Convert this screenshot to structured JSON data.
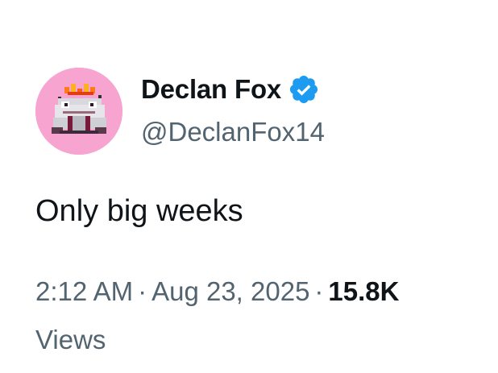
{
  "tweet": {
    "author": {
      "display_name": "Declan Fox",
      "handle": "@DeclanFox14",
      "verified": true,
      "verified_icon": "verified-badge-icon",
      "avatar_icon": "pixel-frog-avatar"
    },
    "text": "Only big weeks",
    "time": "2:12 AM",
    "separator": "·",
    "date": "Aug 23, 2025",
    "views_count": "15.8K",
    "views_label": "Views"
  },
  "colors": {
    "text_primary": "#0f1419",
    "text_secondary": "#536471",
    "verified_blue": "#1d9bf0",
    "avatar_background": "#f7a4d1"
  }
}
